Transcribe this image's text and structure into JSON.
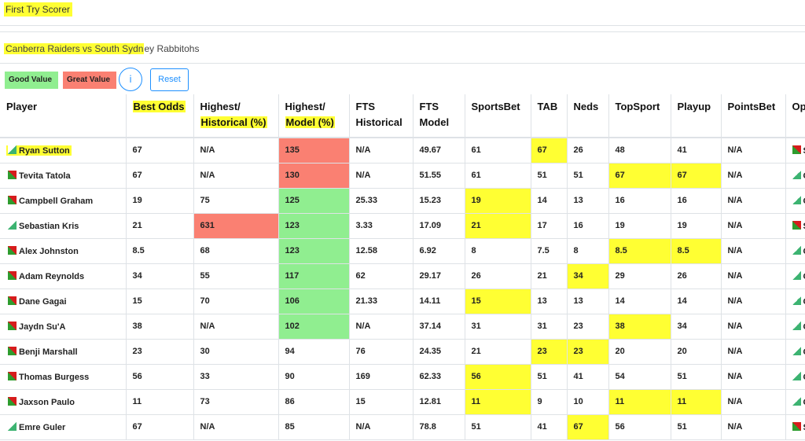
{
  "page_title": "First Try Scorer",
  "match": {
    "highlighted": "Canberra Raiders vs South Sydn",
    "rest": "ey Rabbitohs"
  },
  "legend": {
    "good_value": "Good Value",
    "great_value": "Great Value",
    "info_label": "i",
    "reset_label": "Reset"
  },
  "colors": {
    "highlight": "#ffff33",
    "good_value": "#90ee90",
    "great_value": "#fa8072",
    "button_accent": "#1e90ff"
  },
  "columns": [
    {
      "l1": "Player",
      "l2": "",
      "hl": false
    },
    {
      "l1": "Best Odds",
      "l2": "",
      "hl": true
    },
    {
      "l1": "Highest/",
      "l2": "Historical (%)",
      "hl": "l2"
    },
    {
      "l1": "Highest/",
      "l2": "Model (%)",
      "hl": "l2"
    },
    {
      "l1": "FTS",
      "l2": "Historical",
      "hl": false
    },
    {
      "l1": "FTS",
      "l2": "Model",
      "hl": false
    },
    {
      "l1": "SportsBet",
      "l2": "",
      "hl": false
    },
    {
      "l1": "TAB",
      "l2": "",
      "hl": false
    },
    {
      "l1": "Neds",
      "l2": "",
      "hl": false
    },
    {
      "l1": "TopSport",
      "l2": "",
      "hl": false
    },
    {
      "l1": "Playup",
      "l2": "",
      "hl": false
    },
    {
      "l1": "PointsBet",
      "l2": "",
      "hl": false
    },
    {
      "l1": "Op",
      "l2": "",
      "hl": false
    }
  ],
  "rows": [
    {
      "player": "Ryan Sutton",
      "icon": "triangle-icon",
      "name_hl": true,
      "cells": [
        "67",
        "N/A",
        "135",
        "N/A",
        "49.67",
        "61",
        "67",
        "26",
        "48",
        "41",
        "N/A",
        "S"
      ],
      "styles": [
        "",
        "",
        "r",
        "",
        "",
        "",
        "y",
        "",
        "",
        "",
        "",
        ""
      ],
      "last_icon": "square-icon"
    },
    {
      "player": "Tevita Tatola",
      "icon": "square-icon",
      "name_hl": false,
      "cells": [
        "67",
        "N/A",
        "130",
        "N/A",
        "51.55",
        "61",
        "51",
        "51",
        "67",
        "67",
        "N/A",
        "C"
      ],
      "styles": [
        "",
        "",
        "r",
        "",
        "",
        "",
        "",
        "",
        "y",
        "y",
        "",
        ""
      ],
      "last_icon": "triangle-icon"
    },
    {
      "player": "Campbell Graham",
      "icon": "square-icon",
      "name_hl": false,
      "cells": [
        "19",
        "75",
        "125",
        "25.33",
        "15.23",
        "19",
        "14",
        "13",
        "16",
        "16",
        "N/A",
        "C"
      ],
      "styles": [
        "",
        "",
        "g",
        "",
        "",
        "y",
        "",
        "",
        "",
        "",
        "",
        ""
      ],
      "last_icon": "triangle-icon"
    },
    {
      "player": "Sebastian Kris",
      "icon": "triangle-icon",
      "name_hl": false,
      "cells": [
        "21",
        "631",
        "123",
        "3.33",
        "17.09",
        "21",
        "17",
        "16",
        "19",
        "19",
        "N/A",
        "S"
      ],
      "styles": [
        "",
        "r",
        "g",
        "",
        "",
        "y",
        "",
        "",
        "",
        "",
        "",
        ""
      ],
      "last_icon": "square-icon"
    },
    {
      "player": "Alex Johnston",
      "icon": "square-icon",
      "name_hl": false,
      "cells": [
        "8.5",
        "68",
        "123",
        "12.58",
        "6.92",
        "8",
        "7.5",
        "8",
        "8.5",
        "8.5",
        "N/A",
        "C"
      ],
      "styles": [
        "",
        "",
        "g",
        "",
        "",
        "",
        "",
        "",
        "y",
        "y",
        "",
        ""
      ],
      "last_icon": "triangle-icon"
    },
    {
      "player": "Adam Reynolds",
      "icon": "square-icon",
      "name_hl": false,
      "cells": [
        "34",
        "55",
        "117",
        "62",
        "29.17",
        "26",
        "21",
        "34",
        "29",
        "26",
        "N/A",
        "C"
      ],
      "styles": [
        "",
        "",
        "g",
        "",
        "",
        "",
        "",
        "y",
        "",
        "",
        "",
        ""
      ],
      "last_icon": "triangle-icon"
    },
    {
      "player": "Dane Gagai",
      "icon": "square-icon",
      "name_hl": false,
      "cells": [
        "15",
        "70",
        "106",
        "21.33",
        "14.11",
        "15",
        "13",
        "13",
        "14",
        "14",
        "N/A",
        "C"
      ],
      "styles": [
        "",
        "",
        "g",
        "",
        "",
        "y",
        "",
        "",
        "",
        "",
        "",
        ""
      ],
      "last_icon": "triangle-icon"
    },
    {
      "player": "Jaydn Su'A",
      "icon": "square-icon",
      "name_hl": false,
      "cells": [
        "38",
        "N/A",
        "102",
        "N/A",
        "37.14",
        "31",
        "31",
        "23",
        "38",
        "34",
        "N/A",
        "C"
      ],
      "styles": [
        "",
        "",
        "g",
        "",
        "",
        "",
        "",
        "",
        "y",
        "",
        "",
        ""
      ],
      "last_icon": "triangle-icon"
    },
    {
      "player": "Benji Marshall",
      "icon": "square-icon",
      "name_hl": false,
      "cells": [
        "23",
        "30",
        "94",
        "76",
        "24.35",
        "21",
        "23",
        "23",
        "20",
        "20",
        "N/A",
        "C"
      ],
      "styles": [
        "",
        "",
        "",
        "",
        "",
        "",
        "y",
        "y",
        "",
        "",
        "",
        ""
      ],
      "last_icon": "triangle-icon"
    },
    {
      "player": "Thomas Burgess",
      "icon": "square-icon",
      "name_hl": false,
      "cells": [
        "56",
        "33",
        "90",
        "169",
        "62.33",
        "56",
        "51",
        "41",
        "54",
        "51",
        "N/A",
        "C"
      ],
      "styles": [
        "",
        "",
        "",
        "",
        "",
        "y",
        "",
        "",
        "",
        "",
        "",
        ""
      ],
      "last_icon": "triangle-icon"
    },
    {
      "player": "Jaxson Paulo",
      "icon": "square-icon",
      "name_hl": false,
      "cells": [
        "11",
        "73",
        "86",
        "15",
        "12.81",
        "11",
        "9",
        "10",
        "11",
        "11",
        "N/A",
        "C"
      ],
      "styles": [
        "",
        "",
        "",
        "",
        "",
        "y",
        "",
        "",
        "y",
        "y",
        "",
        ""
      ],
      "last_icon": "triangle-icon"
    },
    {
      "player": "Emre Guler",
      "icon": "triangle-icon",
      "name_hl": false,
      "cells": [
        "67",
        "N/A",
        "85",
        "N/A",
        "78.8",
        "51",
        "41",
        "67",
        "56",
        "51",
        "N/A",
        "S"
      ],
      "styles": [
        "",
        "",
        "",
        "",
        "",
        "",
        "",
        "y",
        "",
        "",
        "",
        ""
      ],
      "last_icon": "square-icon"
    }
  ]
}
